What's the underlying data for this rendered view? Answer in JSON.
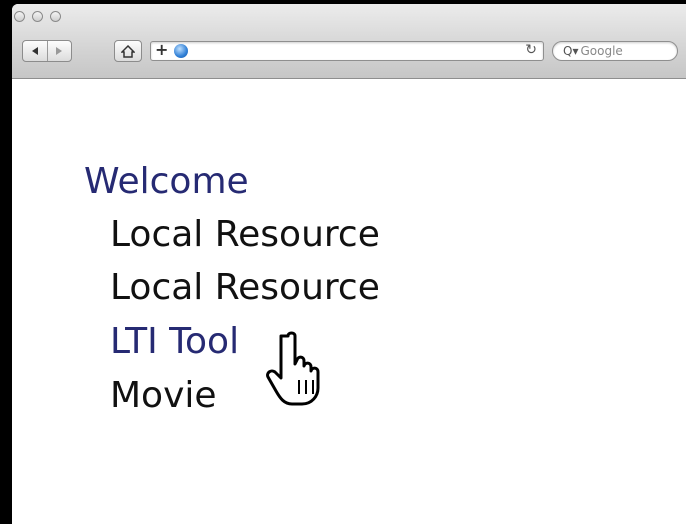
{
  "browser": {
    "address": {
      "url": ""
    },
    "search": {
      "placeholder": "Google"
    },
    "icons": {
      "back": "back-arrow-icon",
      "forward": "forward-arrow-icon",
      "home": "home-icon",
      "add_bookmark": "plus-icon",
      "site": "globe-icon",
      "reload": "reload-icon",
      "search": "search-icon"
    }
  },
  "nav": {
    "items": [
      {
        "label": "Welcome",
        "kind": "link"
      },
      {
        "label": "Local Resource",
        "kind": "text"
      },
      {
        "label": "Local Resource",
        "kind": "text"
      },
      {
        "label": "LTI Tool",
        "kind": "link"
      },
      {
        "label": "Movie",
        "kind": "text"
      }
    ]
  },
  "colors": {
    "link": "#262a73",
    "text": "#111111",
    "background": "#ffffff",
    "chrome": "#d4d4d4"
  },
  "cursor": {
    "type": "hand-pointer-icon"
  }
}
